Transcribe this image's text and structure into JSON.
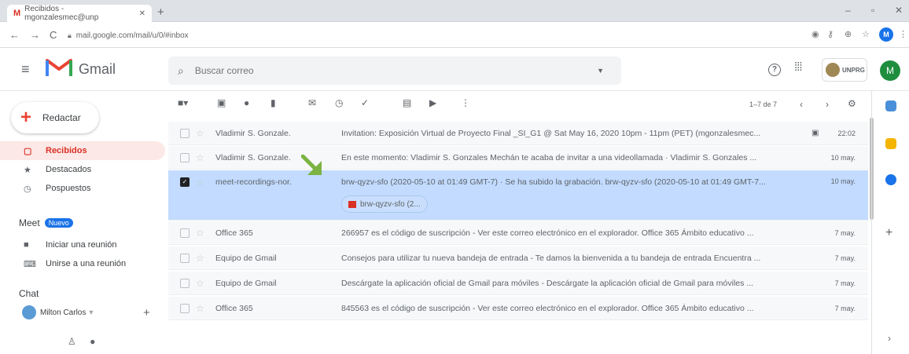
{
  "browser": {
    "tab_title": "Recibidos - mgonzalesmec@unp",
    "tab_favicon": "M",
    "new_tab": "+",
    "url": "mail.google.com/mail/u/0/#inbox",
    "profile_initial": "M"
  },
  "header": {
    "app_name": "Gmail",
    "search_placeholder": "Buscar correo",
    "org_badge": "UNPRG",
    "avatar_initial": "M"
  },
  "sidebar": {
    "compose_label": "Redactar",
    "items": [
      {
        "label": "Recibidos",
        "icon": "inbox-icon",
        "active": true
      },
      {
        "label": "Destacados",
        "icon": "star-icon"
      },
      {
        "label": "Pospuestos",
        "icon": "clock-icon"
      }
    ],
    "meet": {
      "title": "Meet",
      "badge": "Nuevo",
      "items": [
        {
          "label": "Iniciar una reunión",
          "icon": "video-icon"
        },
        {
          "label": "Unirse a una reunión",
          "icon": "keyboard-icon"
        }
      ]
    },
    "chat": {
      "title": "Chat",
      "user": "Milton Carlos"
    }
  },
  "toolbar": {
    "page_info": "1–7 de 7"
  },
  "emails": [
    {
      "sender": "Vladimir S. Gonzale.",
      "snippet": "Invitation: Exposición Virtual de Proyecto Final _SI_G1 @ Sat May 16, 2020 10pm - 11pm (PET) (mgonzalesmec...",
      "date": "22:02",
      "selected": false,
      "calendar_icon": true
    },
    {
      "sender": "Vladimir S. Gonzale.",
      "snippet": "En este momento: Vladimir S. Gonzales Mechán te acaba de invitar a una videollamada · Vladimir S. Gonzales ...",
      "date": "10 may.",
      "selected": false
    },
    {
      "sender": "meet-recordings-nor.",
      "snippet": "brw-qyzv-sfo (2020-05-10 at 01:49 GMT-7) · Se ha subido la grabación. brw-qyzv-sfo (2020-05-10 at 01:49 GMT-7...",
      "date": "10 may.",
      "selected": true,
      "attachment": "brw-qyzv-sfo (2..."
    },
    {
      "sender": "Office 365",
      "snippet": "266957 es el código de suscripción - Ver este correo electrónico en el explorador. Office 365 Ámbito educativo ...",
      "date": "7 may.",
      "selected": false
    },
    {
      "sender": "Equipo de Gmail",
      "snippet": "Consejos para utilizar tu nueva bandeja de entrada - Te damos la bienvenida a tu bandeja de entrada Encuentra ...",
      "date": "7 may.",
      "selected": false
    },
    {
      "sender": "Equipo de Gmail",
      "snippet": "Descárgate la aplicación oficial de Gmail para móviles - Descárgate la aplicación oficial de Gmail para móviles ...",
      "date": "7 may.",
      "selected": false
    },
    {
      "sender": "Office 365",
      "snippet": "845563 es el código de suscripción - Ver este correo electrónico en el explorador. Office 365 Ámbito educativo ...",
      "date": "7 may.",
      "selected": false
    }
  ],
  "colors": {
    "accent": "#d93025",
    "selected_row": "#c2dbff",
    "annotation_arrow": "#7cb342"
  }
}
